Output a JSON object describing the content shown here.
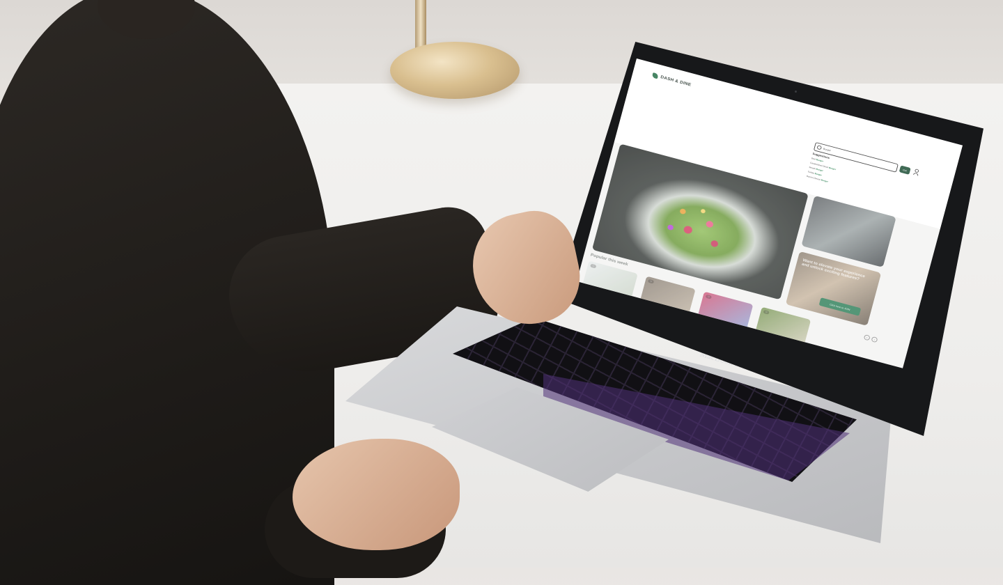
{
  "brand": {
    "name": "DASH & DINE"
  },
  "search": {
    "value": "Burger",
    "button": "Go!"
  },
  "suggestions": {
    "title": "Suggestions",
    "items": [
      {
        "prefix": "Beef ",
        "match": "Burger"
      },
      {
        "prefix": "Caramelized Onion ",
        "match": "Burger"
      },
      {
        "prefix": "Smash ",
        "match": "Burger"
      },
      {
        "prefix": "Turkey ",
        "match": "Burger"
      },
      {
        "prefix": "Bacon Cheese ",
        "match": "Burger"
      }
    ]
  },
  "promo": {
    "title": "Want to elevate your experience and unlock exciting features?",
    "button": "Click here to JOIN"
  },
  "popular": {
    "title": "Popular this week"
  },
  "device": {
    "label": "MacBook Pro"
  },
  "colors": {
    "brand_green": "#1f6b43",
    "button_green": "#174a30",
    "accent_green": "#1f7a48"
  }
}
